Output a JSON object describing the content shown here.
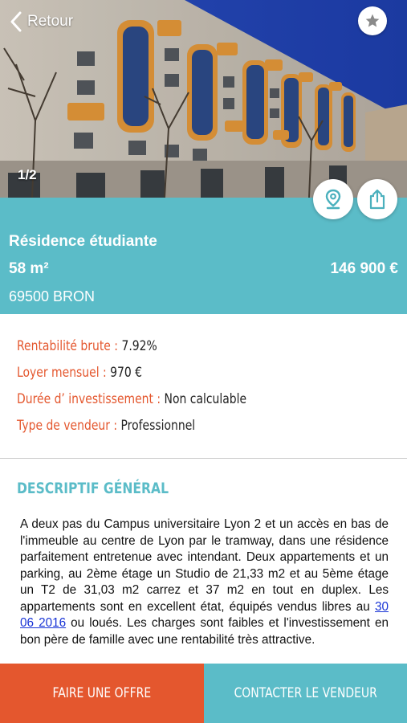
{
  "nav": {
    "back_label": "Retour"
  },
  "gallery": {
    "counter": "1/2"
  },
  "listing": {
    "title": "Résidence étudiante",
    "area": "58 m²",
    "price": "146 900 €",
    "city": "69500 BRON"
  },
  "details": [
    {
      "label": "Rentabilité brute :",
      "value": "7.92%"
    },
    {
      "label": "Loyer mensuel :",
      "value": "970 €"
    },
    {
      "label": "Durée d’ investissement :",
      "value": "Non calculable"
    },
    {
      "label": "Type de vendeur :",
      "value": "Professionnel"
    }
  ],
  "description": {
    "heading": "DESCRIPTIF GÉNÉRAL",
    "text_before": "A deux pas du Campus universitaire Lyon 2 et un accès en bas de l'immeuble au centre de Lyon par le tramway, dans une résidence parfaitement entretenue avec intendant. Deux appartements et un parking, au 2ème étage un Studio de 21,33 m2 et au 5ème étage un T2 de 31,03 m2 carrez et 37 m2 en tout en duplex. Les appartements sont en excellent état, équipés vendus libres au ",
    "link": "30 06 2016",
    "text_after": " ou loués. Les charges sont faibles et l'investissement en bon père de famille avec une rentabilité très attractive."
  },
  "actions": {
    "offer_label": "FAIRE UNE OFFRE",
    "contact_label": "CONTACTER LE VENDEUR"
  },
  "icons": {
    "back": "chevron-left-icon",
    "favorite": "star-icon",
    "map": "map-pin-icon",
    "share": "share-icon"
  },
  "colors": {
    "teal": "#5bbcc8",
    "orange": "#e4572e",
    "link": "#1a35d6"
  }
}
